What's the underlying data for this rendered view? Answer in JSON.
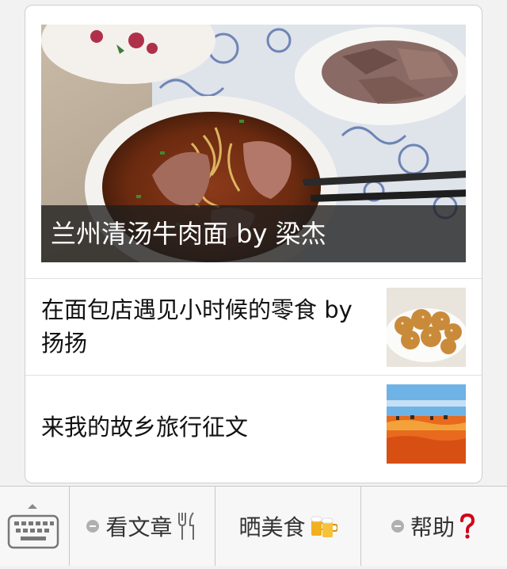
{
  "hero": {
    "caption": "兰州清汤牛肉面 by 梁杰"
  },
  "articles": [
    {
      "title": "在面包店遇见小时候的零食 by 扬扬"
    },
    {
      "title": "来我的故乡旅行征文"
    }
  ],
  "menu": {
    "keyboard_icon": "keyboard-icon",
    "items": [
      {
        "label": "看文章",
        "icon": "fork-knife-icon",
        "has_submenu": true
      },
      {
        "label": "晒美食",
        "icon": "beer-mugs-icon",
        "has_submenu": false
      },
      {
        "label": "帮助",
        "icon": "question-mark-icon",
        "has_submenu": true
      }
    ]
  },
  "colors": {
    "caption_bg": "#1e1e1e",
    "menubar_bg": "#f7f7f7",
    "question_red": "#d0021b"
  }
}
